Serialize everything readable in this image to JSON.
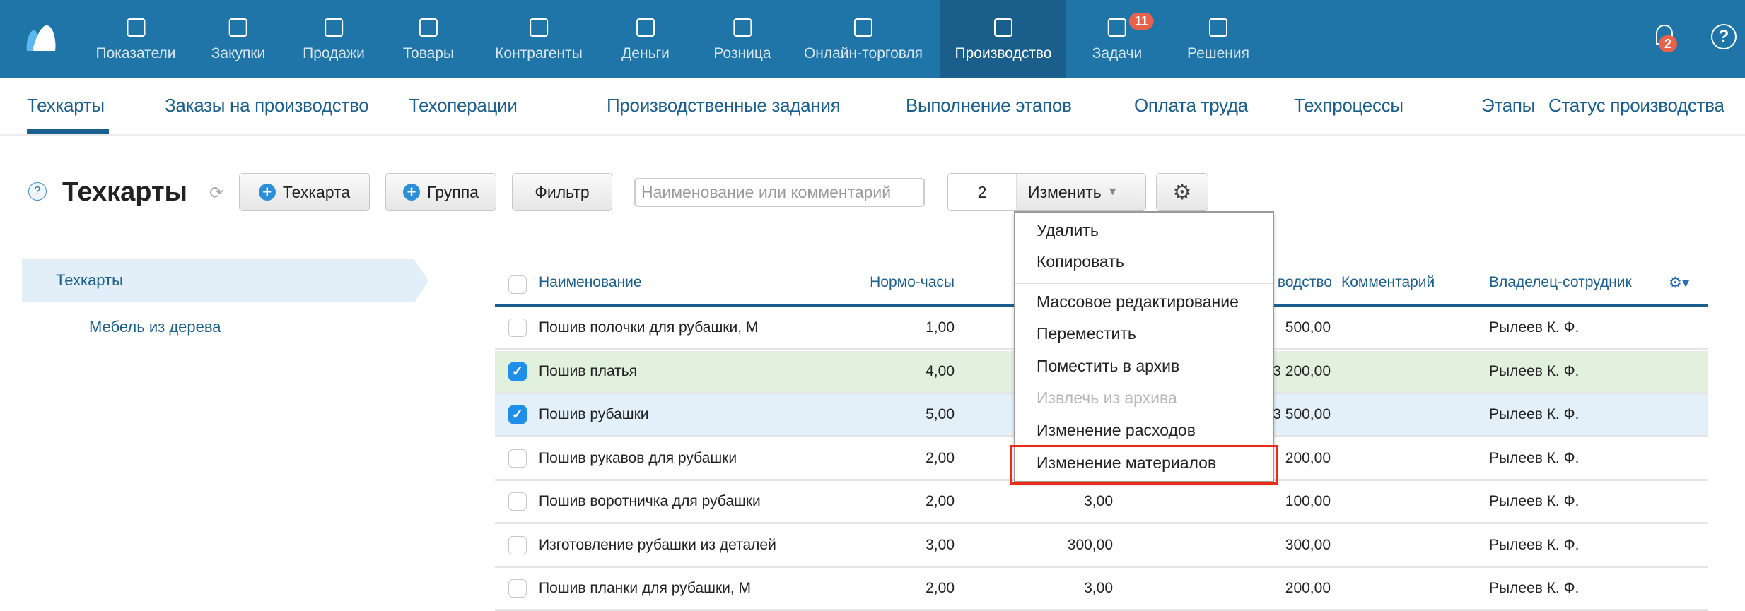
{
  "top_nav": {
    "items": [
      {
        "label": "Показатели",
        "icon": "chart-line-icon"
      },
      {
        "label": "Закупки",
        "icon": "hand-truck-icon"
      },
      {
        "label": "Продажи",
        "icon": "shopping-bag-icon"
      },
      {
        "label": "Товары",
        "icon": "cart-icon"
      },
      {
        "label": "Контрагенты",
        "icon": "people-icon"
      },
      {
        "label": "Деньги",
        "icon": "wallet-icon"
      },
      {
        "label": "Розница",
        "icon": "store-icon"
      },
      {
        "label": "Онлайн-торговля",
        "icon": "online-store-icon"
      },
      {
        "label": "Производство",
        "icon": "factory-icon",
        "active": true
      },
      {
        "label": "Задачи",
        "icon": "checkbox-icon",
        "badge": "11"
      },
      {
        "label": "Решения",
        "icon": "apps-icon"
      }
    ],
    "notifications_badge": "2",
    "colors": {
      "bar": "#1f75a8",
      "active": "#1a5f8c",
      "badge": "#e8614a"
    }
  },
  "sub_nav": {
    "items": [
      "Техкарты",
      "Заказы на производство",
      "Техоперации",
      "Производственные задания",
      "Выполнение этапов",
      "Оплата труда",
      "Техпроцессы",
      "Этапы",
      "Статус производства"
    ],
    "active": "Техкарты"
  },
  "toolbar": {
    "title": "Техкарты",
    "add_techcard": "Техкарта",
    "add_group": "Группа",
    "filter": "Фильтр",
    "search_placeholder": "Наименование или комментарий",
    "selected_count": "2",
    "change_label": "Изменить"
  },
  "dropdown": {
    "items": [
      {
        "label": "Удалить"
      },
      {
        "label": "Копировать"
      },
      {
        "label": "Массовое редактирование"
      },
      {
        "label": "Переместить"
      },
      {
        "label": "Поместить в архив"
      },
      {
        "label": "Извлечь из архива",
        "disabled": true
      },
      {
        "label": "Изменение расходов"
      },
      {
        "label": "Изменение материалов",
        "highlighted": true
      }
    ]
  },
  "sidebar": {
    "items": [
      {
        "label": "Техкарты",
        "selected": true
      },
      {
        "label": "Мебель из дерева"
      }
    ]
  },
  "table": {
    "headers": {
      "name": "Наименование",
      "hours": "Нормо-часы",
      "production": "водство",
      "comment": "Комментарий",
      "owner": "Владелец-сотрудник"
    },
    "rows": [
      {
        "checked": false,
        "name": "Пошив полочки для рубашки, М",
        "hours": "1,00",
        "col3": "",
        "production": "500,00",
        "owner": "Рылеев К. Ф."
      },
      {
        "checked": true,
        "name": "Пошив платья",
        "hours": "4,00",
        "col3": "",
        "production": "3 200,00",
        "owner": "Рылеев К. Ф.",
        "bg": "#e1f1de"
      },
      {
        "checked": true,
        "name": "Пошив рубашки",
        "hours": "5,00",
        "col3": "",
        "production": "3 500,00",
        "owner": "Рылеев К. Ф.",
        "bg": "#e3f0fa"
      },
      {
        "checked": false,
        "name": "Пошив рукавов для рубашки",
        "hours": "2,00",
        "col3": "",
        "production": "200,00",
        "owner": "Рылеев К. Ф."
      },
      {
        "checked": false,
        "name": "Пошив воротничка для рубашки",
        "hours": "2,00",
        "col3": "3,00",
        "production": "100,00",
        "owner": "Рылеев К. Ф."
      },
      {
        "checked": false,
        "name": "Изготовление рубашки из деталей",
        "hours": "3,00",
        "col3": "300,00",
        "production": "300,00",
        "owner": "Рылеев К. Ф."
      },
      {
        "checked": false,
        "name": "Пошив планки для рубашки, М",
        "hours": "2,00",
        "col3": "3,00",
        "production": "200,00",
        "owner": "Рылеев К. Ф."
      }
    ]
  }
}
